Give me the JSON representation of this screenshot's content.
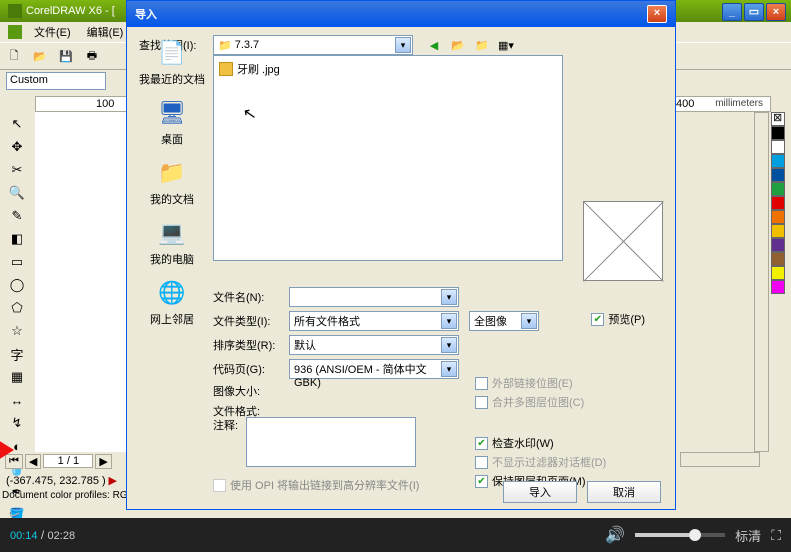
{
  "app": {
    "title": "CorelDRAW X6 - ["
  },
  "menu": {
    "file": "文件(E)",
    "edit": "编辑(E)"
  },
  "units_combo": "Custom",
  "ruler": {
    "n1": "100",
    "n2": "400",
    "units": "millimeters"
  },
  "pagebar": {
    "first": "⏮",
    "prev": "◀",
    "label": "1 / 1",
    "next": "▶"
  },
  "status": {
    "coords": "(-367.475, 232.785 )",
    "triangle": "▶",
    "profile": "Document color profiles: RGB: s"
  },
  "dialog": {
    "title": "导入",
    "lookin_label": "查找范围(I):",
    "lookin_value": "7.3.7",
    "file_item": "牙刷 .jpg",
    "places": {
      "recent": "我最近的文档",
      "desktop": "桌面",
      "mydocs": "我的文档",
      "mycomp": "我的电脑",
      "network": "网上邻居"
    },
    "labels": {
      "filename": "文件名(N):",
      "filetype": "文件类型(I):",
      "sort": "排序类型(R):",
      "codepage": "代码页(G):",
      "imagesize": "图像大小:",
      "fileformat": "文件格式:",
      "notes": "注释:"
    },
    "values": {
      "filename": "",
      "filetype": "所有文件格式",
      "sort": "默认",
      "codepage": "936  (ANSI/OEM - 简体中文 GBK)",
      "fullimage": "全图像"
    },
    "preview_label": "预览(P)",
    "checks": {
      "ext_bitmap": "外部链接位图(E)",
      "merge_layer": "合并多图层位图(C)",
      "watermark": "检查水印(W)",
      "filter_dlg": "不显示过滤器对话框(D)",
      "keep_layers": "保持图层和页面(M)"
    },
    "opi": "使用 OPI 将输出链接到高分辨率文件(I)",
    "buttons": {
      "import": "导入",
      "cancel": "取消"
    }
  },
  "colors": [
    "#ffffff",
    "#000000",
    "#003399",
    "#3366cc",
    "#339933",
    "#cc0000",
    "#ff6600",
    "#ffcc00",
    "#663399",
    "#996633"
  ],
  "video": {
    "current": "00:14",
    "total": "02:28",
    "quality": "标清"
  }
}
